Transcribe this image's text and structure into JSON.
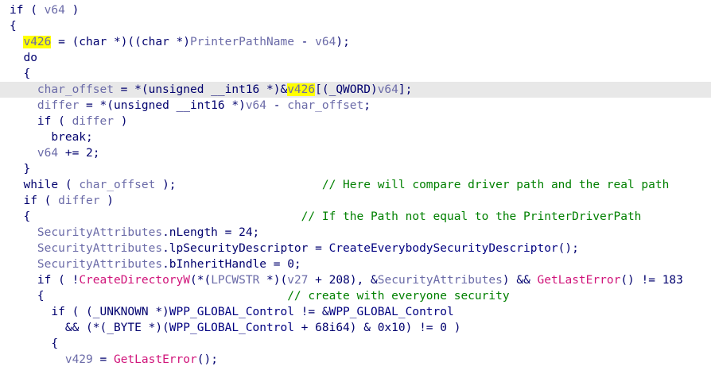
{
  "editor": {
    "lines": [
      {
        "parts": [
          {
            "t": "if ( ",
            "c": "kw"
          },
          {
            "t": "v64",
            "c": "var"
          },
          {
            "t": " )",
            "c": "kw"
          }
        ]
      },
      {
        "parts": [
          {
            "t": "{",
            "c": "kw"
          }
        ]
      },
      {
        "parts": [
          {
            "t": "  "
          },
          {
            "t": "v426",
            "c": "var",
            "hl": true
          },
          {
            "t": " = (char *)((char *)",
            "c": "kw"
          },
          {
            "t": "PrinterPathName",
            "c": "var"
          },
          {
            "t": " - ",
            "c": "kw"
          },
          {
            "t": "v64",
            "c": "var"
          },
          {
            "t": ");",
            "c": "kw"
          }
        ]
      },
      {
        "parts": [
          {
            "t": "  do",
            "c": "kw"
          }
        ]
      },
      {
        "parts": [
          {
            "t": "  {",
            "c": "kw"
          }
        ]
      },
      {
        "current": true,
        "parts": [
          {
            "t": "    "
          },
          {
            "t": "char_offset",
            "c": "var"
          },
          {
            "t": " = *(unsigned __int16 *)&",
            "c": "kw"
          },
          {
            "t": "v426",
            "c": "var",
            "hl": true
          },
          {
            "t": "[(_QWORD)",
            "c": "kw"
          },
          {
            "t": "v64",
            "c": "var"
          },
          {
            "t": "];",
            "c": "kw"
          }
        ]
      },
      {
        "parts": [
          {
            "t": "    "
          },
          {
            "t": "differ",
            "c": "var"
          },
          {
            "t": " = *(unsigned __int16 *)",
            "c": "kw"
          },
          {
            "t": "v64",
            "c": "var"
          },
          {
            "t": " - ",
            "c": "kw"
          },
          {
            "t": "char_offset",
            "c": "var"
          },
          {
            "t": ";",
            "c": "kw"
          }
        ]
      },
      {
        "parts": [
          {
            "t": "    if ( ",
            "c": "kw"
          },
          {
            "t": "differ",
            "c": "var"
          },
          {
            "t": " )",
            "c": "kw"
          }
        ]
      },
      {
        "parts": [
          {
            "t": "      break;",
            "c": "kw"
          }
        ]
      },
      {
        "parts": [
          {
            "t": "    "
          },
          {
            "t": "v64",
            "c": "var"
          },
          {
            "t": " += 2;",
            "c": "kw"
          }
        ]
      },
      {
        "parts": [
          {
            "t": "  }",
            "c": "kw"
          }
        ]
      },
      {
        "parts": [
          {
            "t": "  while ( ",
            "c": "kw"
          },
          {
            "t": "char_offset",
            "c": "var"
          },
          {
            "t": " );                     ",
            "c": "kw"
          },
          {
            "t": "// Here will compare driver path and the real path",
            "c": "cm"
          }
        ]
      },
      {
        "parts": [
          {
            "t": "  if ( ",
            "c": "kw"
          },
          {
            "t": "differ",
            "c": "var"
          },
          {
            "t": " )",
            "c": "kw"
          }
        ]
      },
      {
        "parts": [
          {
            "t": "  {                                       ",
            "c": "kw"
          },
          {
            "t": "// If the Path not equal to the PrinterDriverPath",
            "c": "cm"
          }
        ]
      },
      {
        "parts": [
          {
            "t": "    "
          },
          {
            "t": "SecurityAttributes",
            "c": "var"
          },
          {
            "t": ".nLength = 24;",
            "c": "kw"
          }
        ]
      },
      {
        "parts": [
          {
            "t": "    "
          },
          {
            "t": "SecurityAttributes",
            "c": "var"
          },
          {
            "t": ".lpSecurityDescriptor = ",
            "c": "kw"
          },
          {
            "t": "CreateEverybodySecurityDescriptor",
            "c": "fn"
          },
          {
            "t": "();",
            "c": "kw"
          }
        ]
      },
      {
        "parts": [
          {
            "t": "    "
          },
          {
            "t": "SecurityAttributes",
            "c": "var"
          },
          {
            "t": ".bInheritHandle = 0;",
            "c": "kw"
          }
        ]
      },
      {
        "parts": [
          {
            "t": "    if ( !",
            "c": "kw"
          },
          {
            "t": "CreateDirectoryW",
            "c": "imp"
          },
          {
            "t": "(*(",
            "c": "kw"
          },
          {
            "t": "LPCWSTR",
            "c": "var"
          },
          {
            "t": " *)(",
            "c": "kw"
          },
          {
            "t": "v27",
            "c": "var"
          },
          {
            "t": " + 208), &",
            "c": "kw"
          },
          {
            "t": "SecurityAttributes",
            "c": "var"
          },
          {
            "t": ") && ",
            "c": "kw"
          },
          {
            "t": "GetLastError",
            "c": "imp"
          },
          {
            "t": "() != 183",
            "c": "kw"
          }
        ]
      },
      {
        "parts": [
          {
            "t": "    {                                   ",
            "c": "kw"
          },
          {
            "t": "// create with everyone security",
            "c": "cm"
          }
        ]
      },
      {
        "parts": [
          {
            "t": "      if ( (_UNKNOWN *)",
            "c": "kw"
          },
          {
            "t": "WPP_GLOBAL_Control",
            "c": "fn"
          },
          {
            "t": " != &",
            "c": "kw"
          },
          {
            "t": "WPP_GLOBAL_Control",
            "c": "fn"
          }
        ]
      },
      {
        "parts": [
          {
            "t": "        && (*(_BYTE *)(",
            "c": "kw"
          },
          {
            "t": "WPP_GLOBAL_Control",
            "c": "fn"
          },
          {
            "t": " + 68i64) & 0x10) != 0 )",
            "c": "kw"
          }
        ]
      },
      {
        "parts": [
          {
            "t": "      {",
            "c": "kw"
          }
        ]
      },
      {
        "parts": [
          {
            "t": "        "
          },
          {
            "t": "v429",
            "c": "var"
          },
          {
            "t": " = ",
            "c": "kw"
          },
          {
            "t": "GetLastError",
            "c": "imp"
          },
          {
            "t": "();",
            "c": "kw"
          }
        ]
      }
    ]
  }
}
